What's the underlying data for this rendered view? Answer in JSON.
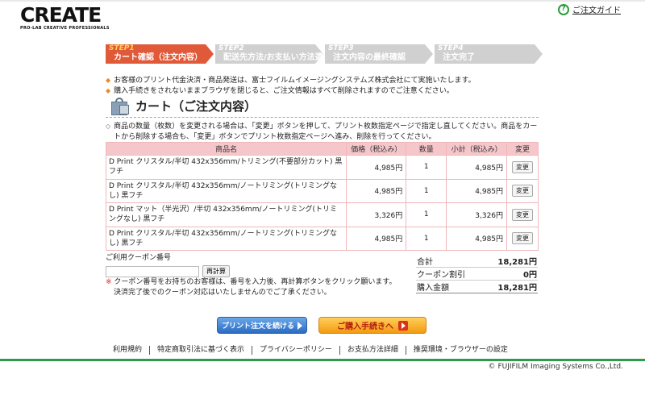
{
  "header": {
    "logo_text": "CREATE",
    "logo_sub": "PRO-LAB CREATIVE PROFESSIONALS",
    "guide_icon": "?",
    "guide_label": "ご注文ガイド"
  },
  "steps": [
    {
      "num": "STEP1",
      "label": "カート確認（注文内容）",
      "active": true
    },
    {
      "num": "STEP2",
      "label": "配送先方法/お支払い方法選択",
      "active": false
    },
    {
      "num": "STEP3",
      "label": "注文内容の最終確認",
      "active": false
    },
    {
      "num": "STEP4",
      "label": "注文完了",
      "active": false
    }
  ],
  "notes": [
    "お客様のプリント代金決済・商品発送は、富士フイルムイメージングシステムズ株式会社にて実施いたします。",
    "購入手続きをされないままブラウザを閉じると、ご注文情報はすべて削除されますのでご注意ください。"
  ],
  "cart": {
    "title": "カート（ご注文内容）",
    "description": "商品の数量（枚数）を変更される場合は、「変更」ボタンを押して、プリント枚数指定ページで指定し直してください。商品をカートから削除する場合も、「変更」ボタンでプリント枚数指定ページへ進み、削除を行ってください。",
    "columns": [
      "商品名",
      "価格（税込み）",
      "数量",
      "小計（税込み）",
      "変更"
    ],
    "rows": [
      {
        "name": "D Print クリスタル/半切 432x356mm/トリミング(不要部分カット) 黒フチ",
        "price": "4,985円",
        "qty": "1",
        "subtotal": "4,985円",
        "change": "変更"
      },
      {
        "name": "D Print クリスタル/半切 432x356mm/ノートリミング(トリミングなし) 黒フチ",
        "price": "4,985円",
        "qty": "1",
        "subtotal": "4,985円",
        "change": "変更"
      },
      {
        "name": "D Print マット（半光沢）/半切 432x356mm/ノートリミング(トリミングなし) 黒フチ",
        "price": "3,326円",
        "qty": "1",
        "subtotal": "3,326円",
        "change": "変更"
      },
      {
        "name": "D Print クリスタル/半切 432x356mm/ノートリミング(トリミングなし) 黒フチ",
        "price": "4,985円",
        "qty": "1",
        "subtotal": "4,985円",
        "change": "変更"
      }
    ]
  },
  "coupon": {
    "label": "ご利用クーポン番号",
    "input_value": "",
    "recalc_label": "再計算",
    "note_line1": "クーポン番号をお持ちのお客様は、番号を入力後、再計算ボタンをクリック願います。",
    "note_line2": "決済完了後でのクーポン対応はいたしませんのでご了承ください。"
  },
  "totals": {
    "sum_label": "合計",
    "sum_value": "18,281円",
    "discount_label": "クーポン割引",
    "discount_value": "0円",
    "final_label": "購入金額",
    "final_value": "18,281円"
  },
  "actions": {
    "continue_label": "プリント注文を続ける",
    "checkout_label": "ご購入手続きへ"
  },
  "footer": {
    "links": [
      "利用規約",
      "特定商取引法に基づく表示",
      "プライバシーポリシー",
      "お支払方法詳細",
      "推奨環境・ブラウザーの設定"
    ],
    "copyright": "FUJIFILM Imaging Systems Co.,Ltd."
  },
  "colors": {
    "active_step": "#e05a3a",
    "inactive_step": "#d0d0d0",
    "table_header": "#f6c7ca",
    "footer_line": "#2e9a4b"
  }
}
